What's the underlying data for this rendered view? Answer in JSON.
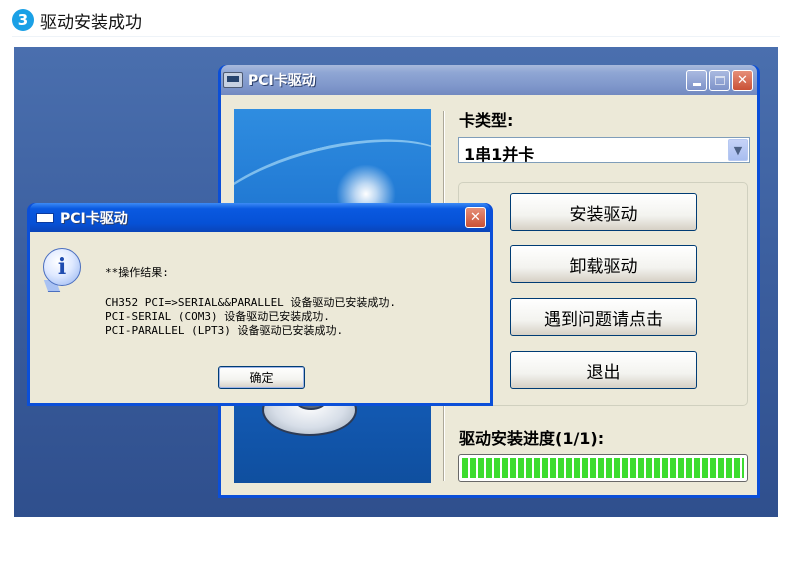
{
  "step": {
    "number": "3",
    "title": "驱动安装成功"
  },
  "main_window": {
    "title": "PCI卡驱动",
    "card_type_label": "卡类型:",
    "card_type_value": "1串1并卡",
    "buttons": {
      "install": "安装驱动",
      "uninstall": "卸载驱动",
      "help": "遇到问题请点击",
      "exit": "退出"
    },
    "progress_label": "驱动安装进度(1/1):",
    "progress_percent": 100
  },
  "dialog": {
    "title": "PCI卡驱动",
    "heading": "**操作结果:",
    "lines": [
      "CH352 PCI=>SERIAL&&PARALLEL 设备驱动已安装成功.",
      "PCI-SERIAL (COM3) 设备驱动已安装成功.",
      "PCI-PARALLEL (LPT3) 设备驱动已安装成功."
    ],
    "ok_label": "确定"
  },
  "colors": {
    "xp_titlebar": "#0651d6",
    "window_face": "#ece9d8",
    "progress_green": "#3ddc2e",
    "close_red": "#c95136"
  }
}
